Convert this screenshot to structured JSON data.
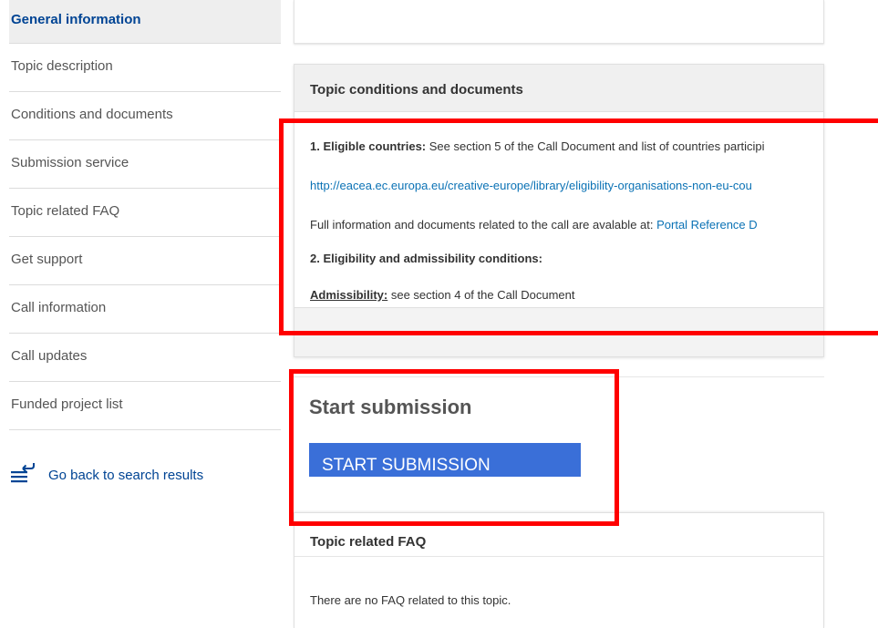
{
  "sidebar": {
    "items": [
      {
        "label": "General information"
      },
      {
        "label": "Topic description"
      },
      {
        "label": "Conditions and documents"
      },
      {
        "label": "Submission service"
      },
      {
        "label": "Topic related FAQ"
      },
      {
        "label": "Get support"
      },
      {
        "label": "Call information"
      },
      {
        "label": "Call updates"
      },
      {
        "label": "Funded project list"
      }
    ],
    "back_link": {
      "label": "Go back to search results",
      "icon": "back-list-icon"
    }
  },
  "conditions": {
    "title": "Topic conditions and documents",
    "eligible_label": "1. Eligible countries:",
    "eligible_text": " See section 5 of the Call Document  and list of countries participi",
    "eligible_url": "http://eacea.ec.europa.eu/creative-europe/library/eligibility-organisations-non-eu-cou",
    "full_info_text": "Full information and documents related to the call are avalable at: ",
    "full_info_link": "Portal Reference D",
    "eligibility_heading": "2. Eligibility and admissibility conditions:",
    "admissibility_label": "Admissibility:",
    "admissibility_text": " see section 4 of the Call Document"
  },
  "submission": {
    "title": "Start submission",
    "button_label": "START SUBMISSION"
  },
  "faq": {
    "title": "Topic related FAQ",
    "empty_text": "There are no FAQ related to this topic."
  },
  "colors": {
    "highlight": "#ff0000",
    "button": "#3a6fd8",
    "active_nav": "#004494",
    "link": "#0b72b5"
  }
}
